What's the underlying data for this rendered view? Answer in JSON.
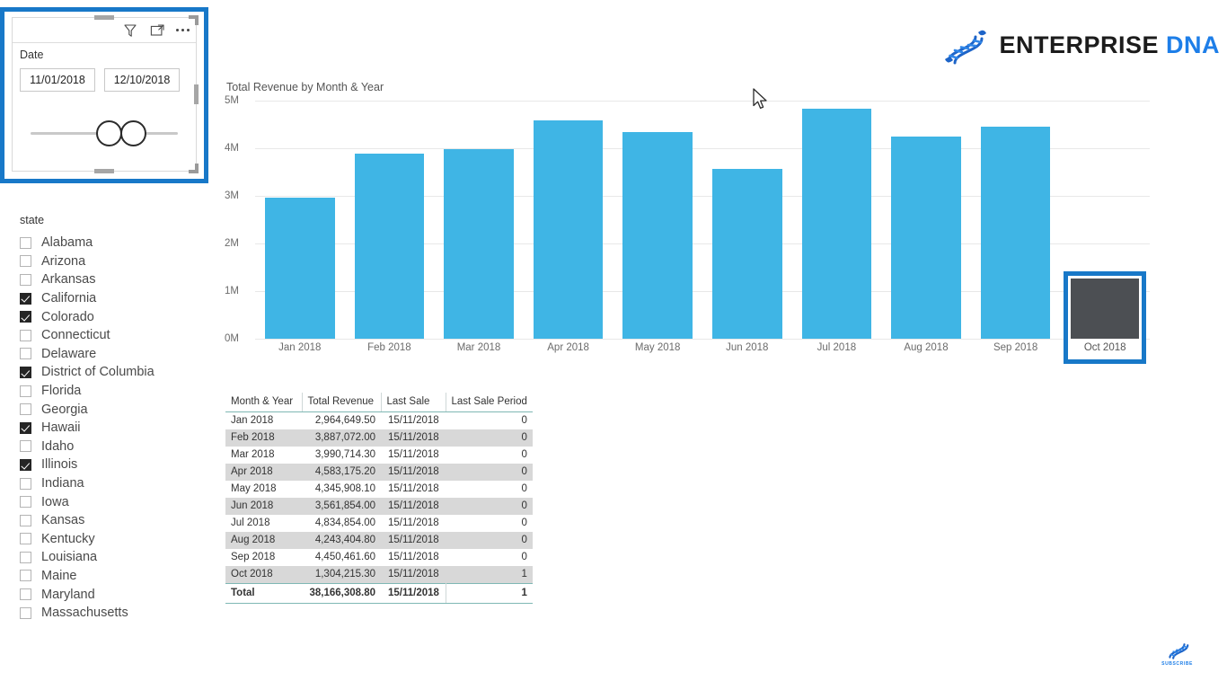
{
  "date_slicer": {
    "title": "Date",
    "start_date": "11/01/2018",
    "end_date": "12/10/2018",
    "icons": {
      "filter": "filter-icon",
      "focus": "focus-mode-icon",
      "more": "more-options-icon"
    }
  },
  "state_slicer": {
    "title": "state",
    "items": [
      {
        "label": "Alabama",
        "checked": false
      },
      {
        "label": "Arizona",
        "checked": false
      },
      {
        "label": "Arkansas",
        "checked": false
      },
      {
        "label": "California",
        "checked": true
      },
      {
        "label": "Colorado",
        "checked": true
      },
      {
        "label": "Connecticut",
        "checked": false
      },
      {
        "label": "Delaware",
        "checked": false
      },
      {
        "label": "District of Columbia",
        "checked": true
      },
      {
        "label": "Florida",
        "checked": false
      },
      {
        "label": "Georgia",
        "checked": false
      },
      {
        "label": "Hawaii",
        "checked": true
      },
      {
        "label": "Idaho",
        "checked": false
      },
      {
        "label": "Illinois",
        "checked": true
      },
      {
        "label": "Indiana",
        "checked": false
      },
      {
        "label": "Iowa",
        "checked": false
      },
      {
        "label": "Kansas",
        "checked": false
      },
      {
        "label": "Kentucky",
        "checked": false
      },
      {
        "label": "Louisiana",
        "checked": false
      },
      {
        "label": "Maine",
        "checked": false
      },
      {
        "label": "Maryland",
        "checked": false
      },
      {
        "label": "Massachusetts",
        "checked": false
      }
    ]
  },
  "chart_data": {
    "type": "bar",
    "title": "Total Revenue by Month & Year",
    "xlabel": "",
    "ylabel": "",
    "ylim": [
      0,
      5000000
    ],
    "grid": true,
    "legend": false,
    "bar_color": "#3fb5e5",
    "selected_bar_color": "#4c4f53",
    "selection_border_color": "#1878c8",
    "selected_category": "Oct 2018",
    "ytick_labels": [
      "5M",
      "4M",
      "3M",
      "2M",
      "1M",
      "0M"
    ],
    "ytick_values": [
      5000000,
      4000000,
      3000000,
      2000000,
      1000000,
      0
    ],
    "categories": [
      "Jan 2018",
      "Feb 2018",
      "Mar 2018",
      "Apr 2018",
      "May 2018",
      "Jun 2018",
      "Jul 2018",
      "Aug 2018",
      "Sep 2018",
      "Oct 2018"
    ],
    "values": [
      2964649.5,
      3887072.0,
      3990714.3,
      4583175.2,
      4345908.1,
      3561854.0,
      4834854.0,
      4243404.8,
      4450461.6,
      1304215.3
    ]
  },
  "table": {
    "columns": [
      "Month & Year",
      "Total Revenue",
      "Last Sale",
      "Last Sale Period"
    ],
    "rows": [
      {
        "month": "Jan 2018",
        "revenue": "2,964,649.50",
        "last_sale": "15/11/2018",
        "period": "0"
      },
      {
        "month": "Feb 2018",
        "revenue": "3,887,072.00",
        "last_sale": "15/11/2018",
        "period": "0"
      },
      {
        "month": "Mar 2018",
        "revenue": "3,990,714.30",
        "last_sale": "15/11/2018",
        "period": "0"
      },
      {
        "month": "Apr 2018",
        "revenue": "4,583,175.20",
        "last_sale": "15/11/2018",
        "period": "0"
      },
      {
        "month": "May 2018",
        "revenue": "4,345,908.10",
        "last_sale": "15/11/2018",
        "period": "0"
      },
      {
        "month": "Jun 2018",
        "revenue": "3,561,854.00",
        "last_sale": "15/11/2018",
        "period": "0"
      },
      {
        "month": "Jul 2018",
        "revenue": "4,834,854.00",
        "last_sale": "15/11/2018",
        "period": "0"
      },
      {
        "month": "Aug 2018",
        "revenue": "4,243,404.80",
        "last_sale": "15/11/2018",
        "period": "0"
      },
      {
        "month": "Sep 2018",
        "revenue": "4,450,461.60",
        "last_sale": "15/11/2018",
        "period": "0"
      },
      {
        "month": "Oct 2018",
        "revenue": "1,304,215.30",
        "last_sale": "15/11/2018",
        "period": "1"
      }
    ],
    "total": {
      "month": "Total",
      "revenue": "38,166,308.80",
      "last_sale": "15/11/2018",
      "period": "1"
    }
  },
  "logo": {
    "primary": "ENTERPRISE",
    "secondary": "DNA",
    "primary_color": "#1c1c1c",
    "secondary_color": "#1d7ee8"
  },
  "subscribe": {
    "label": "SUBSCRIBE"
  }
}
